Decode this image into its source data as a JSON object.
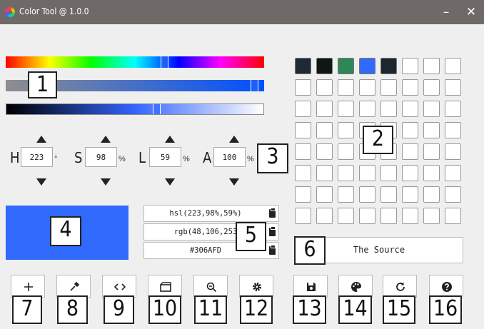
{
  "window": {
    "title": "Color Tool @ 1.0.0",
    "minimize_label": "–",
    "close_label": "✕"
  },
  "sliders": {
    "hue_level": 0.62,
    "saturation_level": 0.98,
    "lightness_level": 0.59
  },
  "fields": [
    {
      "label": "H",
      "value": "223",
      "unit": "°"
    },
    {
      "label": "S",
      "value": "98",
      "unit": "%"
    },
    {
      "label": "L",
      "value": "59",
      "unit": "%"
    },
    {
      "label": "A",
      "value": "100",
      "unit": "%"
    }
  ],
  "preview": {
    "color": "#306afd"
  },
  "codes": [
    {
      "text": "hsl(223,98%,59%)"
    },
    {
      "text": "rgb(48,106,253"
    },
    {
      "text": "#306AFD"
    }
  ],
  "palette": {
    "saved_colors": [
      "#1f2a34",
      "#101616",
      "#2e8856",
      "#306afd",
      "#1e262d"
    ],
    "empty_color": "#ffffff"
  },
  "source_button": {
    "label": "The Source"
  },
  "toolbar": [
    {
      "icon": "plus-icon"
    },
    {
      "icon": "eyedropper-icon"
    },
    {
      "icon": "code-icon"
    },
    {
      "icon": "clapperboard-icon"
    },
    {
      "icon": "zoom-out-icon"
    },
    {
      "icon": "gear-icon"
    },
    {
      "icon": "save-icon"
    },
    {
      "icon": "palette-icon"
    },
    {
      "icon": "refresh-icon"
    },
    {
      "icon": "help-icon"
    }
  ],
  "callouts": [
    "1",
    "2",
    "3",
    "4",
    "5",
    "6",
    "7",
    "8",
    "9",
    "10",
    "11",
    "12",
    "13",
    "14",
    "15",
    "16"
  ]
}
